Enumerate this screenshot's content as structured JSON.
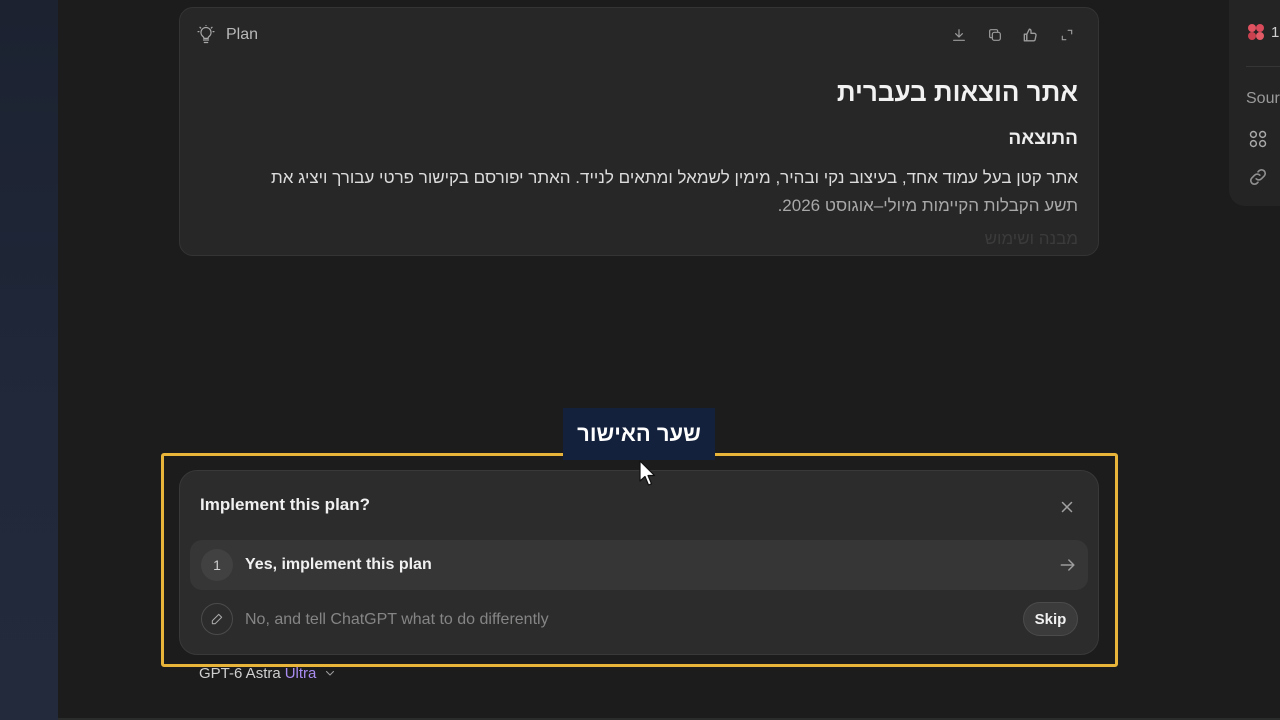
{
  "plan": {
    "label": "Plan",
    "title": "אתר הוצאות בעברית",
    "section_title": "התוצאה",
    "paragraph_line1": "אתר קטן בעל עמוד אחד, בעיצוב נקי ובהיר, מימין לשמאל ומתאים לנייד. האתר יפורסם בקישור פרטי עבורך ויציג את",
    "paragraph_line2": "תשע הקבלות הקיימות מיולי–אוגוסט 2026.",
    "next_heading_partial": "מבנה ושימוש",
    "tools": [
      "download-icon",
      "copy-icon",
      "feedback-icon",
      "expand-icon"
    ]
  },
  "right_panel": {
    "count_partial": "1",
    "sources_partial": "Sour"
  },
  "annotation": {
    "label": "שער האישור",
    "accent_color": "#e8b43a"
  },
  "dialog": {
    "title": "Implement this plan?",
    "option_yes": {
      "number": "1",
      "label": "Yes, implement this plan"
    },
    "option_no": {
      "placeholder": "No, and tell ChatGPT what to do differently"
    },
    "skip_label": "Skip"
  },
  "model_selector": {
    "name": "GPT-6 Astra",
    "tier": "Ultra",
    "tier_color": "#a98cf0"
  }
}
